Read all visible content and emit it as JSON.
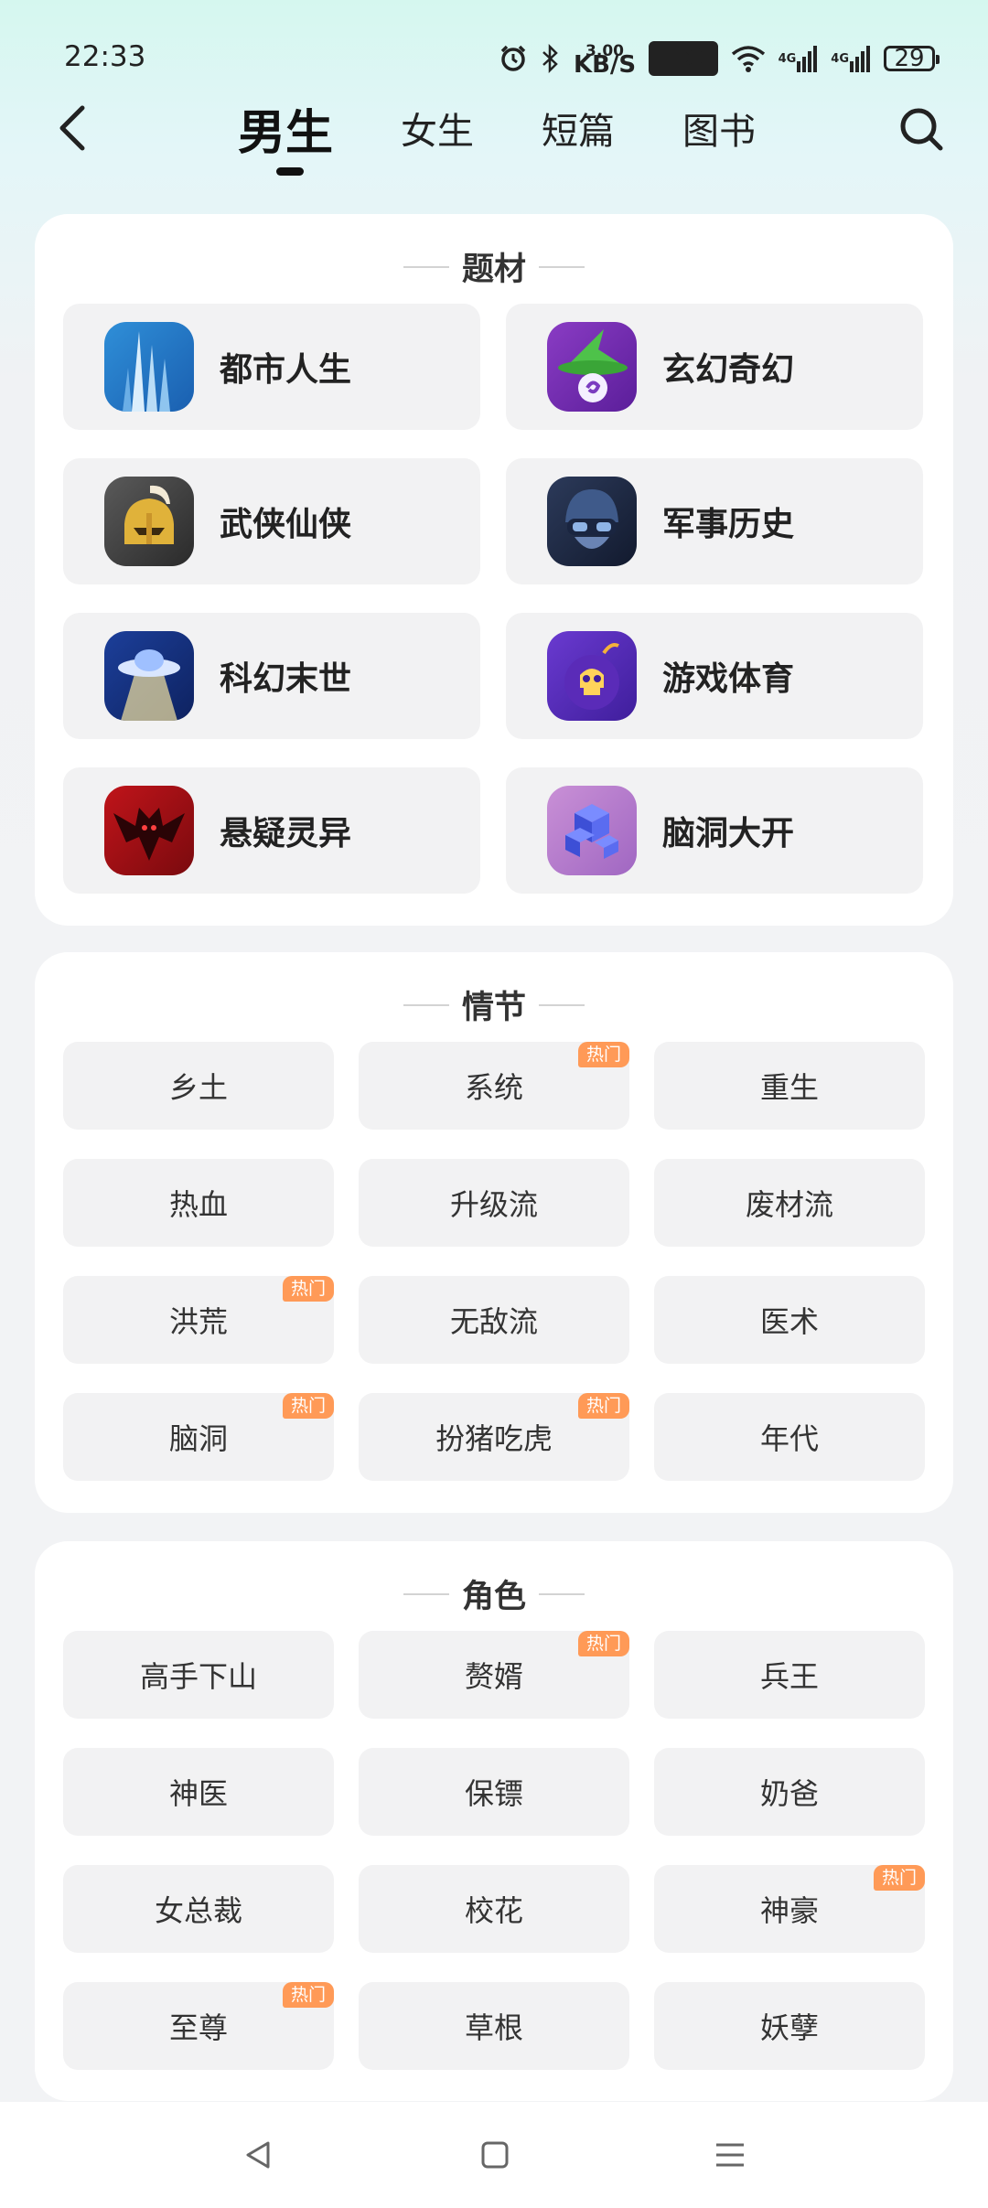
{
  "status": {
    "time": "22:33",
    "speed_value": "3.00",
    "speed_unit": "KB/S",
    "hd_label": "HD1",
    "net1": "4G",
    "net2": "4G",
    "battery": "29"
  },
  "header": {
    "tabs": [
      {
        "label": "男生",
        "active": true
      },
      {
        "label": "女生",
        "active": false
      },
      {
        "label": "短篇",
        "active": false
      },
      {
        "label": "图书",
        "active": false
      }
    ]
  },
  "genre_section": {
    "title": "题材",
    "items": [
      {
        "label": "都市人生",
        "icon": "city-skyscraper-icon"
      },
      {
        "label": "玄幻奇幻",
        "icon": "wizard-hat-icon"
      },
      {
        "label": "武侠仙侠",
        "icon": "warrior-helmet-icon"
      },
      {
        "label": "军事历史",
        "icon": "soldier-icon"
      },
      {
        "label": "科幻末世",
        "icon": "ufo-icon"
      },
      {
        "label": "游戏体育",
        "icon": "skull-bomb-icon"
      },
      {
        "label": "悬疑灵异",
        "icon": "demon-bat-icon"
      },
      {
        "label": "脑洞大开",
        "icon": "cube-puzzle-icon"
      }
    ]
  },
  "plot_section": {
    "title": "情节",
    "hot_label": "热门",
    "items": [
      {
        "label": "乡土",
        "hot": false
      },
      {
        "label": "系统",
        "hot": true
      },
      {
        "label": "重生",
        "hot": false
      },
      {
        "label": "热血",
        "hot": false
      },
      {
        "label": "升级流",
        "hot": false
      },
      {
        "label": "废材流",
        "hot": false
      },
      {
        "label": "洪荒",
        "hot": true
      },
      {
        "label": "无敌流",
        "hot": false
      },
      {
        "label": "医术",
        "hot": false
      },
      {
        "label": "脑洞",
        "hot": true
      },
      {
        "label": "扮猪吃虎",
        "hot": true
      },
      {
        "label": "年代",
        "hot": false
      }
    ]
  },
  "role_section": {
    "title": "角色",
    "hot_label": "热门",
    "items": [
      {
        "label": "高手下山",
        "hot": false
      },
      {
        "label": "赘婿",
        "hot": true
      },
      {
        "label": "兵王",
        "hot": false
      },
      {
        "label": "神医",
        "hot": false
      },
      {
        "label": "保镖",
        "hot": false
      },
      {
        "label": "奶爸",
        "hot": false
      },
      {
        "label": "女总裁",
        "hot": false
      },
      {
        "label": "校花",
        "hot": false
      },
      {
        "label": "神豪",
        "hot": true
      },
      {
        "label": "至尊",
        "hot": true
      },
      {
        "label": "草根",
        "hot": false
      },
      {
        "label": "妖孽",
        "hot": false
      }
    ]
  },
  "colors": {
    "hot_badge": "#ff9a57",
    "card_bg": "#ffffff",
    "tile_bg": "#f2f2f3"
  }
}
